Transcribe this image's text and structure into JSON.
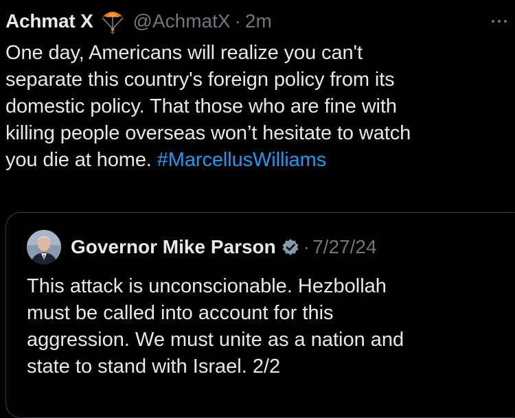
{
  "tweet": {
    "author_name": "Achmat X",
    "author_emoji_icon": "parachute-icon",
    "handle": "@AchmatX",
    "separator": "·",
    "time": "2m",
    "text_lines": [
      "One day, Americans will realize you can't",
      "separate this country's foreign policy from its",
      "domestic policy. That those who are fine with",
      "killing people overseas won’t hesitate to watch",
      "you die at home. "
    ],
    "hashtag": "#MarcellusWilliams"
  },
  "quote": {
    "author_name": "Governor Mike Parson",
    "badge_icon": "government-verified-badge-icon",
    "separator": "·",
    "date": "7/27/24",
    "text_lines": [
      "This attack is unconscionable. Hezbollah",
      "must be called into account for this",
      "aggression. We must unite as a nation and",
      "state to stand with Israel. 2/2"
    ]
  },
  "colors": {
    "background": "#000000",
    "text": "#e7e9ea",
    "muted": "#71767b",
    "link": "#1d9bf0",
    "border": "#3a3f44"
  }
}
